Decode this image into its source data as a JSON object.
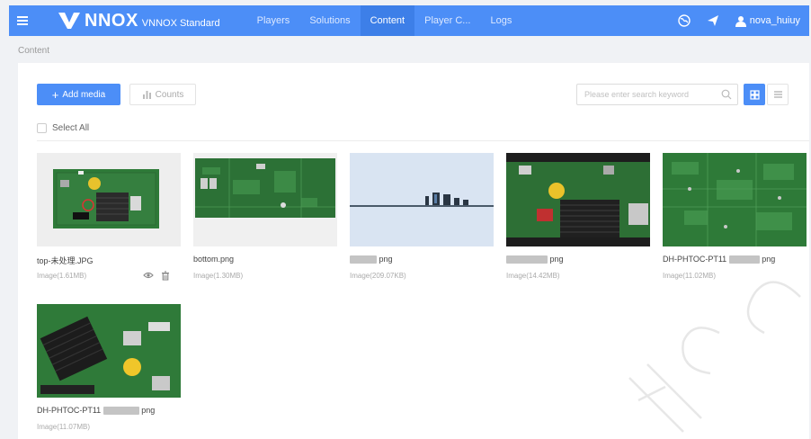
{
  "app": {
    "brand": "NNOX",
    "edition": "VNNOX Standard"
  },
  "nav": {
    "items": [
      {
        "label": "Players",
        "active": false
      },
      {
        "label": "Solutions",
        "active": false
      },
      {
        "label": "Content",
        "active": true
      },
      {
        "label": "Player C...",
        "active": false
      },
      {
        "label": "Logs",
        "active": false
      }
    ]
  },
  "user": {
    "name": "nova_huiuy"
  },
  "breadcrumb": "Content",
  "toolbar": {
    "add_media_label": "Add media",
    "counts_label": "Counts",
    "search_placeholder": "Please enter search keyword"
  },
  "select_all_label": "Select All",
  "media": [
    {
      "name": "top-未处理.JPG",
      "meta": "Image(1.61MB)",
      "thumb": "board-white"
    },
    {
      "name": "bottom.png",
      "meta": "Image(1.30MB)",
      "thumb": "board-green"
    },
    {
      "name": "png",
      "meta": "Image(209.07KB)",
      "thumb": "side-view"
    },
    {
      "name": "png",
      "meta": "Image(14.42MB)",
      "thumb": "board-dark"
    },
    {
      "name": "DH-PHTOC-PT11",
      "name_suffix": "png",
      "meta": "Image(11.02MB)",
      "thumb": "board-plain"
    },
    {
      "name": "DH-PHTOC-PT11",
      "name_suffix": "png",
      "meta": "Image(11.07MB)",
      "thumb": "board-heatsink"
    }
  ],
  "icons": {
    "menu": "hamburger-icon",
    "globe": "globe-icon",
    "send": "paper-plane-icon",
    "user": "user-icon",
    "search": "search-icon",
    "grid": "grid-view-icon",
    "list": "list-view-icon",
    "preview": "eye-icon",
    "delete": "trash-icon",
    "counts": "bar-chart-icon"
  },
  "colors": {
    "primary": "#4c8ef7",
    "nav_active": "#3d7fe8",
    "background": "#f0f2f5",
    "pcb_green": "#2f7a3a"
  }
}
